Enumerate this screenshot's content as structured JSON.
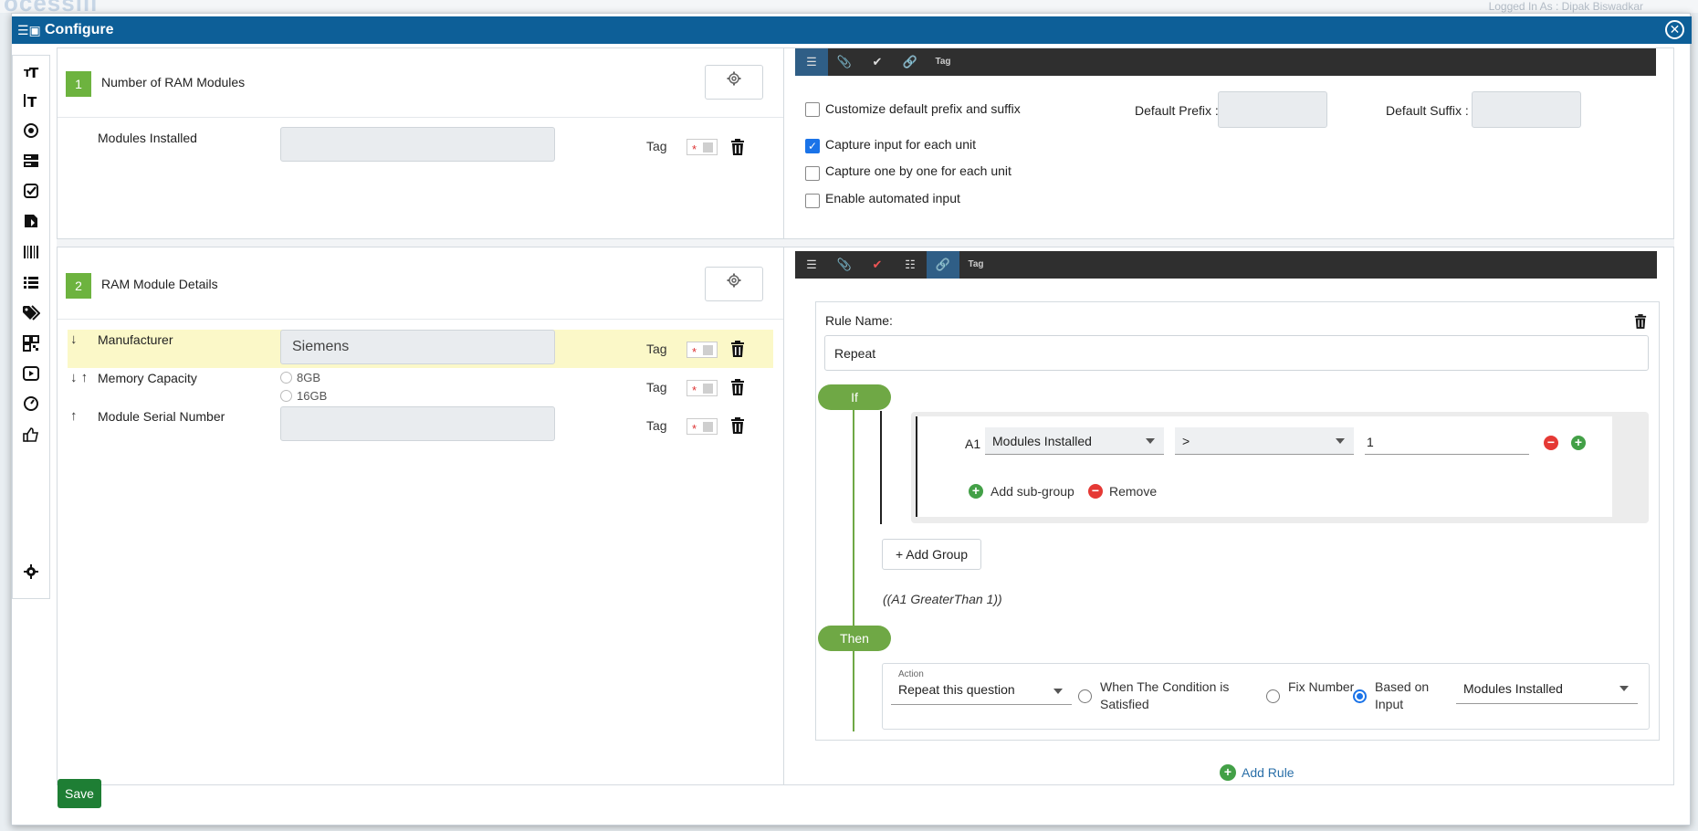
{
  "modal": {
    "title": "Configure",
    "close_label": "✕"
  },
  "toolbox": {
    "items": [
      {
        "name": "text-icon"
      },
      {
        "name": "long-text-icon"
      },
      {
        "name": "radio-icon"
      },
      {
        "name": "list-box-icon"
      },
      {
        "name": "checkbox-icon"
      },
      {
        "name": "save-file-icon"
      },
      {
        "name": "barcode-icon"
      },
      {
        "name": "list-icon"
      },
      {
        "name": "tags-icon"
      },
      {
        "name": "qr-code-icon"
      },
      {
        "name": "video-icon"
      },
      {
        "name": "gauge-icon"
      },
      {
        "name": "thumbs-up-icon"
      },
      {
        "name": "settings-gear-icon"
      }
    ]
  },
  "question1": {
    "number": "1",
    "title": "Number of RAM Modules",
    "field_label": "Modules Installed",
    "field_value": "",
    "tag_label": "Tag",
    "required_mark": "*"
  },
  "question1_options": {
    "customize_label": "Customize default prefix and suffix",
    "customize_checked": false,
    "default_prefix_label": "Default Prefix :",
    "default_prefix_value": "",
    "default_suffix_label": "Default Suffix :",
    "default_suffix_value": "",
    "capture_each_label": "Capture input for each unit",
    "capture_each_checked": true,
    "capture_one_label": "Capture one by one for each unit",
    "capture_one_checked": false,
    "automated_label": "Enable automated input",
    "automated_checked": false
  },
  "question2": {
    "number": "2",
    "title": "RAM Module Details",
    "tag_label": "Tag",
    "required_mark": "*",
    "rows": [
      {
        "arrows": "↓",
        "label": "Manufacturer",
        "value": "Siemens"
      },
      {
        "arrows": "↓ ↑",
        "label": "Memory Capacity",
        "options": [
          "8GB",
          "16GB"
        ]
      },
      {
        "arrows": "↑",
        "label": "Module Serial Number",
        "value": ""
      }
    ]
  },
  "toolbar_top": {
    "tag_label": "Tag"
  },
  "toolbar_bottom": {
    "tag_label": "Tag"
  },
  "rule": {
    "name_label": "Rule Name:",
    "name_value": "Repeat",
    "if_label": "If",
    "then_label": "Then",
    "condition": {
      "id": "A1",
      "field": "Modules Installed",
      "operator": ">",
      "value": "1"
    },
    "add_subgroup_label": "Add sub-group",
    "remove_label": "Remove",
    "add_group_label": "+ Add Group",
    "expression": "((A1 GreaterThan 1))",
    "action_caption": "Action",
    "action_value": "Repeat this question",
    "option_condition_satisfied": "When The Condition is Satisfied",
    "option_fix_number": "Fix Number",
    "option_based_on_input": "Based on Input",
    "selected_option": "based_on_input",
    "based_on_field": "Modules Installed",
    "add_rule_label": "Add Rule"
  },
  "footer": {
    "save_label": "Save"
  },
  "colors": {
    "header": "#0d5f98",
    "accent_green": "#6fa845",
    "save_green": "#1e7e34",
    "highlight_row": "#fbf8c8"
  }
}
